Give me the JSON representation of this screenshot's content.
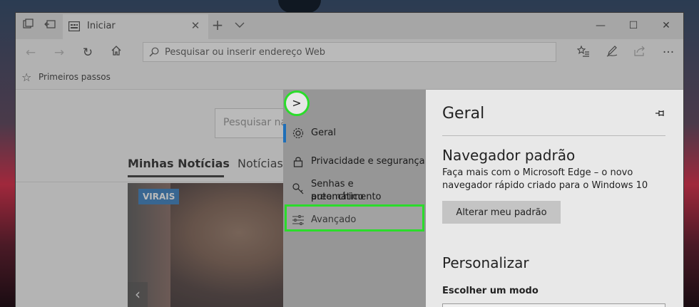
{
  "tab": {
    "title": "Iniciar"
  },
  "address_bar": {
    "placeholder": "Pesquisar ou inserir endereço Web"
  },
  "favorites_bar": {
    "items": [
      {
        "label": "Primeiros passos"
      }
    ]
  },
  "page": {
    "search_placeholder": "Pesquisar na",
    "news_tabs": [
      {
        "label": "Minhas Notícias",
        "active": true
      },
      {
        "label": "Notícias",
        "active": false
      }
    ],
    "featured_badge": "VIRAIS"
  },
  "settings_nav": {
    "items": [
      {
        "label": "Geral",
        "icon": "gear-icon",
        "selected": true
      },
      {
        "label": "Privacidade e segurança",
        "icon": "lock-icon"
      },
      {
        "label_line1": "Senhas e preenchimento",
        "label_line2": "automático",
        "icon": "key-icon"
      },
      {
        "label": "Avançado",
        "icon": "sliders-icon",
        "highlighted": true
      }
    ]
  },
  "settings_pane": {
    "title": "Geral",
    "default_browser": {
      "heading": "Navegador padrão",
      "description": "Faça mais com o Microsoft Edge – o novo navegador rápido criado para o Windows 10",
      "button_label": "Alterar meu padrão"
    },
    "personalize": {
      "heading": "Personalizar",
      "mode_label": "Escolher um modo"
    }
  },
  "colors": {
    "accent": "#1f6fb8",
    "highlight": "#2bdc2b",
    "badge": "#1f6fb8"
  }
}
